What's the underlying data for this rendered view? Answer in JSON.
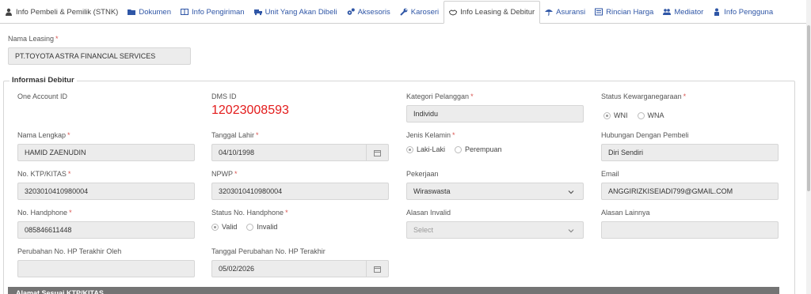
{
  "tabs": [
    {
      "label": "Info Pembeli & Pemilik (STNK)",
      "icon": "user-icon"
    },
    {
      "label": "Dokumen",
      "icon": "folder-icon"
    },
    {
      "label": "Info Pengiriman",
      "icon": "book-icon"
    },
    {
      "label": "Unit Yang Akan Dibeli",
      "icon": "truck-icon"
    },
    {
      "label": "Aksesoris",
      "icon": "gears-icon"
    },
    {
      "label": "Karoseri",
      "icon": "wrench-icon"
    },
    {
      "label": "Info Leasing & Debitur",
      "icon": "handshake-icon"
    },
    {
      "label": "Asuransi",
      "icon": "umbrella-icon"
    },
    {
      "label": "Rincian Harga",
      "icon": "list-icon"
    },
    {
      "label": "Mediator",
      "icon": "users-icon"
    },
    {
      "label": "Info Pengguna",
      "icon": "person-icon"
    }
  ],
  "active_tab": "Info Leasing & Debitur",
  "leasing": {
    "label": "Nama Leasing",
    "value": "PT.TOYOTA ASTRA FINANCIAL SERVICES"
  },
  "debitur": {
    "legend": "Informasi Debitur",
    "one_account_id": {
      "label": "One Account ID"
    },
    "dms_id": {
      "label": "DMS ID",
      "value": "12023008593"
    },
    "kategori_pelanggan": {
      "label": "Kategori Pelanggan",
      "value": "Individu"
    },
    "status_kewarganegaraan": {
      "label": "Status Kewarganegaraan",
      "options": [
        "WNI",
        "WNA"
      ],
      "selected": "WNI"
    },
    "nama_lengkap": {
      "label": "Nama Lengkap",
      "value": "HAMID ZAENUDIN"
    },
    "tanggal_lahir": {
      "label": "Tanggal Lahir",
      "value": "04/10/1998"
    },
    "jenis_kelamin": {
      "label": "Jenis Kelamin",
      "options": [
        "Laki-Laki",
        "Perempuan"
      ],
      "selected": "Laki-Laki"
    },
    "hubungan": {
      "label": "Hubungan Dengan Pembeli",
      "value": "Diri Sendiri"
    },
    "no_ktp": {
      "label": "No. KTP/KITAS",
      "value": "3203010410980004"
    },
    "npwp": {
      "label": "NPWP",
      "value": "3203010410980004"
    },
    "pekerjaan": {
      "label": "Pekerjaan",
      "value": "Wiraswasta"
    },
    "email": {
      "label": "Email",
      "value": "ANGGIRIZKISEIADI799@GMAIL.COM"
    },
    "no_hp": {
      "label": "No. Handphone",
      "value": "085846611448"
    },
    "status_hp": {
      "label": "Status No. Handphone",
      "options": [
        "Valid",
        "Invalid"
      ],
      "selected": "Valid"
    },
    "alasan_invalid": {
      "label": "Alasan Invalid",
      "placeholder": "Select"
    },
    "alasan_lainnya": {
      "label": "Alasan Lainnya"
    },
    "perubahan_hp_oleh": {
      "label": "Perubahan No. HP Terakhir Oleh"
    },
    "tanggal_perubahan": {
      "label": "Tanggal Perubahan No. HP Terakhir",
      "value": "05/02/2026"
    }
  },
  "section_bar": {
    "label": "Alamat Sesuai KTP/KITAS"
  }
}
